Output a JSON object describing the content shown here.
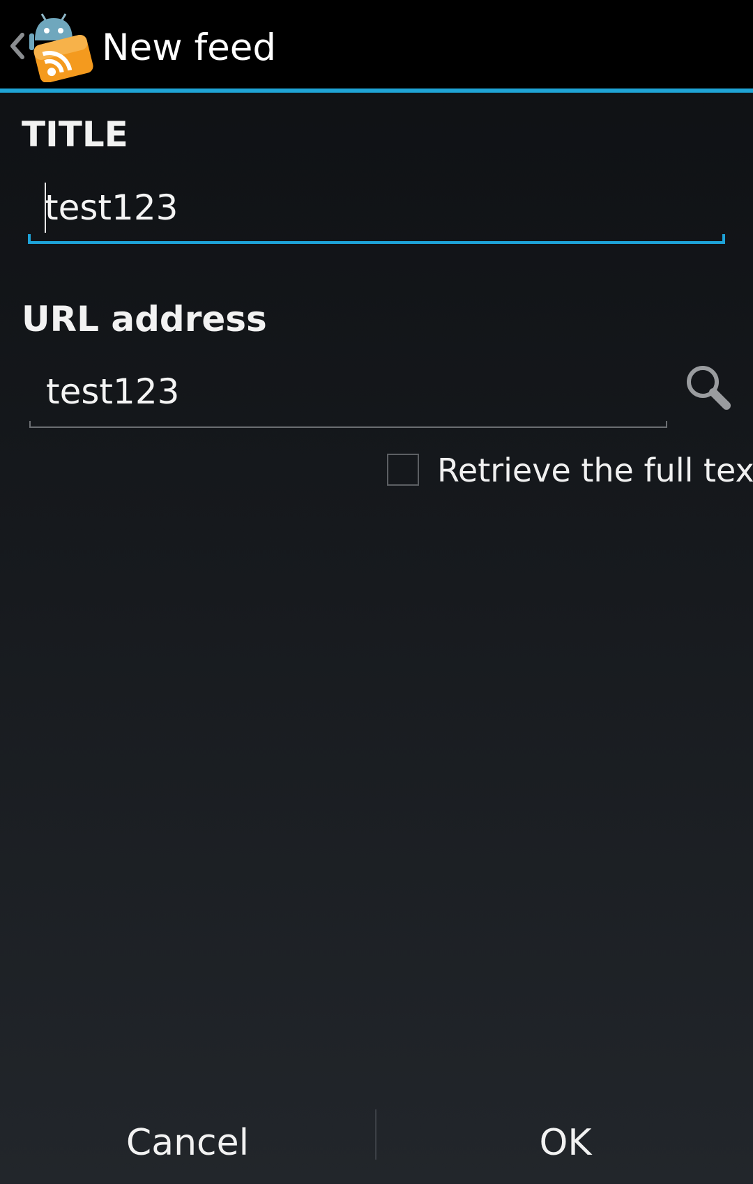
{
  "action_bar": {
    "title": "New feed",
    "back_icon": "chevron-left-icon",
    "app_icon": "rss-android-app-icon",
    "accent_color": "#1fa4d6"
  },
  "form": {
    "title_label": "TITLE",
    "title_value": "test123",
    "url_label": "URL address",
    "url_value": "test123",
    "search_icon": "search-icon",
    "full_text_label": "Retrieve the full text",
    "full_text_checked": false
  },
  "buttons": {
    "cancel": "Cancel",
    "ok": "OK"
  }
}
